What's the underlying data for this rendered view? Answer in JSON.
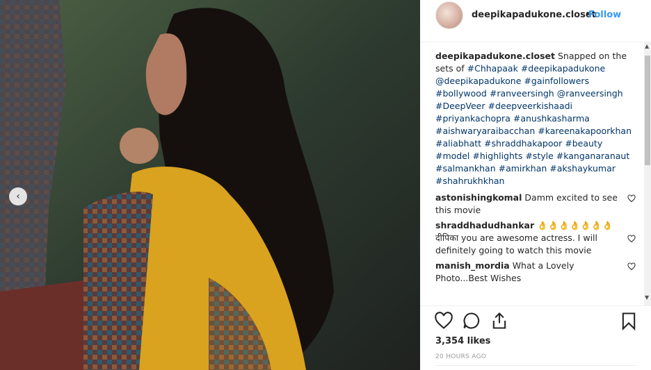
{
  "post": {
    "username": "deepikapadukone.closet",
    "dot": "•",
    "follow_label": "Follow",
    "caption_text": "Snapped on the sets of",
    "caption_tags": [
      "#Chhapaak",
      "#deepikapadukone",
      "@deepikapadukone",
      "#gainfollowers",
      "#bollywood",
      "#ranveersingh",
      "@ranveersingh",
      "#DeepVeer",
      "#deepveerkishaadi",
      "#priyankachopra",
      "#anushkasharma",
      "#aishwaryaraibacchan",
      "#kareenakapoorkhan",
      "#aliabhatt",
      "#shraddhakapoor",
      "#beauty",
      "#model",
      "#highlights",
      "#style",
      "#kanganaranaut",
      "#salmankhan",
      "#amirkhan",
      "#akshaykumar",
      "#shahrukhkhan"
    ]
  },
  "comments": [
    {
      "user": "astonishingkomal",
      "text": "Damm excited to see this movie"
    },
    {
      "user": "shraddhadudhankar",
      "text": "👌👌👌👌👌👌👌 दीपिका you are awesome actress. I will definitely going to watch this movie"
    },
    {
      "user": "manish_mordia",
      "text": "What a Lovely Photo...Best Wishes"
    }
  ],
  "footer": {
    "likes": "3,354 likes",
    "time": "20 HOURS AGO"
  },
  "icons": {
    "like": "heart-icon",
    "comment": "comment-icon",
    "share": "share-icon",
    "save": "bookmark-icon",
    "prev": "chevron-left-icon"
  },
  "colors": {
    "link": "#3897f0",
    "hashtag": "#003569",
    "muted": "#999999"
  }
}
